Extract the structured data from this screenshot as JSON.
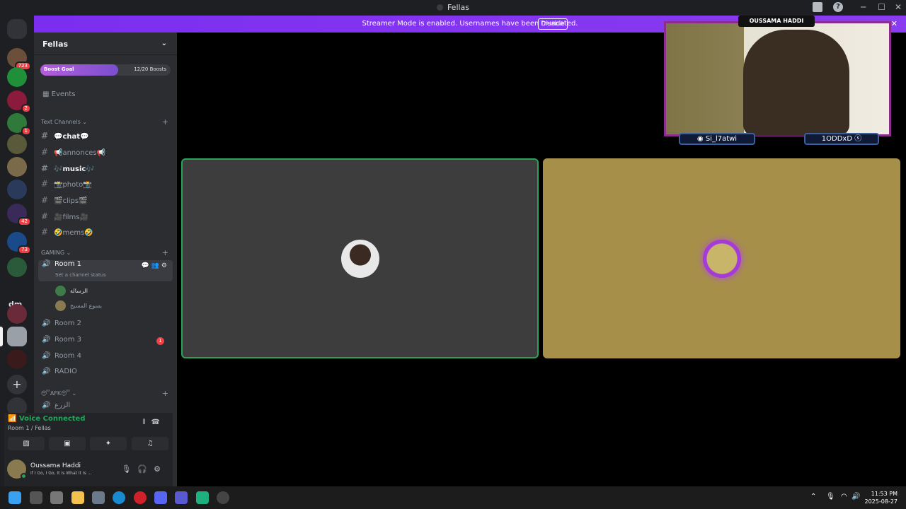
{
  "window": {
    "title": "Fellas"
  },
  "banner": {
    "message": "Streamer Mode is enabled. Usernames have been truncated.",
    "disable_label": "Disable"
  },
  "servers": {
    "badges": [
      "723",
      "1",
      "2",
      "1",
      "42",
      "73"
    ],
    "dm_label": "dm"
  },
  "guild": {
    "name": "Fellas",
    "boost_label": "Boost Goal",
    "boost_count": "12/20 Boosts",
    "boost_progress": 0.6,
    "events_label": "Events"
  },
  "categories": {
    "text": "Text Channels",
    "gaming": "GAMING",
    "afk": "😴AFK😴"
  },
  "text_channels": [
    {
      "label": "💬chat💬",
      "unread": true
    },
    {
      "label": "📢annonces📢",
      "unread": false
    },
    {
      "label": "🎶music🎶",
      "unread": true
    },
    {
      "label": "📸photo📸",
      "unread": false
    },
    {
      "label": "🎬clips🎬",
      "unread": false
    },
    {
      "label": "🎥films🎥",
      "unread": false
    },
    {
      "label": "🤣mems🤣",
      "unread": false
    }
  ],
  "voice_channels": {
    "active": {
      "label": "Room 1",
      "status": "Set a channel status"
    },
    "members": [
      "الرسالة",
      "يسوع المسيح"
    ],
    "others": [
      "Room 2",
      "Room 3",
      "Room 4",
      "RADIO"
    ],
    "room3_badge": "1",
    "afk_channel": "الزرع"
  },
  "voice_panel": {
    "title": "Voice Connected",
    "subtitle": "Room 1 / Fellas"
  },
  "user": {
    "name": "Oussama Haddi",
    "status": "If I Go, I Go, It Is What It Is ..."
  },
  "overlay": {
    "streamer_name": "OUSSAMA HADDI",
    "left_tag": "Si_l7atwi",
    "right_tag": "1ODDxD"
  },
  "taskbar": {
    "time": "11:53 PM",
    "date": "2025-08-27"
  },
  "colors": {
    "accent": "#5865f2",
    "banner": "#8a3cf0",
    "voice_green": "#23a55a",
    "badge_red": "#f23f43"
  }
}
